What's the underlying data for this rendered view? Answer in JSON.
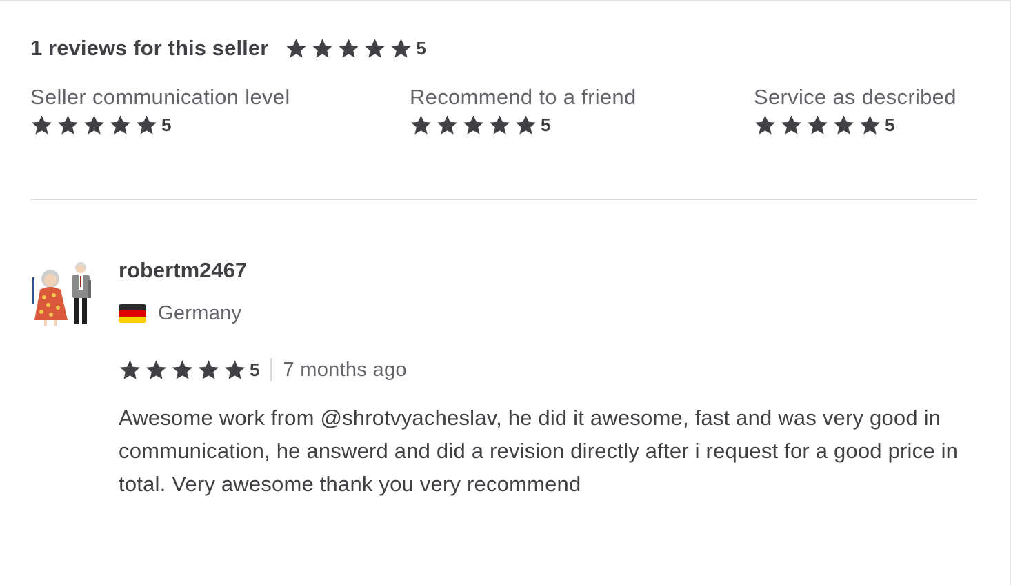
{
  "header": {
    "title": "1 reviews for this seller",
    "overall_rating": "5",
    "overall_stars_value": 5
  },
  "breakdown": [
    {
      "label": "Seller communication level",
      "rating": "5"
    },
    {
      "label": "Recommend to a friend",
      "rating": "5"
    },
    {
      "label": "Service as described",
      "rating": "5"
    }
  ],
  "review": {
    "username": "robertm2467",
    "country": "Germany",
    "rating": "5",
    "time_ago": "7 months ago",
    "text": "Awesome work from @shrotvyacheslav, he did it awesome, fast and was very good in communication, he answerd and did a revision directly after i request for a good price in total. Very awesome thank you very recommend"
  },
  "colors": {
    "star": "#404145",
    "text_primary": "#404145",
    "text_secondary": "#62646a",
    "divider": "#dadbdd",
    "flag_black": "#2b2b2b",
    "flag_red": "#dd0000",
    "flag_gold": "#ffce00"
  },
  "icons": {
    "star": "star-icon",
    "flag": "germany-flag-icon",
    "avatar": "avatar-illustration"
  }
}
